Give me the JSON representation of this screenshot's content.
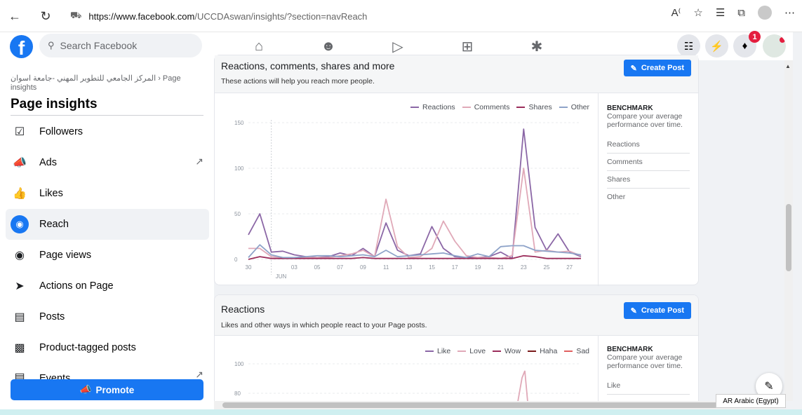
{
  "browser": {
    "url_host": "https://www.facebook.com",
    "url_path": "/UCCDAswan/insights/?section=navReach"
  },
  "fb": {
    "search_placeholder": "Search Facebook",
    "notification_count": "1"
  },
  "sidebar": {
    "breadcrumb": "المركز الجامعي للتطوير المهني -جامعة اسوان › Page insights",
    "title": "Page insights",
    "items": [
      {
        "label": "Followers",
        "icon": "followers-icon"
      },
      {
        "label": "Ads",
        "icon": "megaphone-icon",
        "external": true
      },
      {
        "label": "Likes",
        "icon": "thumbs-up-icon"
      },
      {
        "label": "Reach",
        "icon": "reach-icon",
        "active": true
      },
      {
        "label": "Page views",
        "icon": "eye-icon"
      },
      {
        "label": "Actions on Page",
        "icon": "cursor-icon"
      },
      {
        "label": "Posts",
        "icon": "posts-icon"
      },
      {
        "label": "Product-tagged posts",
        "icon": "tag-icon"
      },
      {
        "label": "Events",
        "icon": "calendar-icon",
        "external": true
      }
    ],
    "promote_label": "Promote"
  },
  "cards": {
    "reach": {
      "title": "Reactions, comments, shares and more",
      "desc": "These actions will help you reach more people.",
      "create_post": "Create Post",
      "benchmark": {
        "title": "BENCHMARK",
        "desc": "Compare your average performance over time.",
        "items": [
          "Reactions",
          "Comments",
          "Shares",
          "Other"
        ]
      }
    },
    "reactions": {
      "title": "Reactions",
      "desc": "Likes and other ways in which people react to your Page posts.",
      "create_post": "Create Post",
      "benchmark": {
        "title": "BENCHMARK",
        "desc": "Compare your average performance over time.",
        "items": [
          "Like"
        ]
      }
    }
  },
  "status": {
    "language": "AR Arabic (Egypt)"
  },
  "chart_data": [
    {
      "type": "line",
      "x": [
        "30",
        "31",
        "01",
        "02",
        "03",
        "04",
        "05",
        "06",
        "07",
        "08",
        "09",
        "10",
        "11",
        "12",
        "13",
        "14",
        "15",
        "16",
        "17",
        "18",
        "19",
        "20",
        "21",
        "22",
        "23",
        "24",
        "25",
        "26",
        "27",
        "28"
      ],
      "tick_labels": [
        "30",
        "03",
        "05",
        "07",
        "09",
        "11",
        "13",
        "15",
        "17",
        "19",
        "21",
        "23",
        "25",
        "27"
      ],
      "month_label": "JUN",
      "ylim": [
        0,
        150
      ],
      "yticks": [
        0,
        50,
        100,
        150
      ],
      "legend_position": "top-right",
      "series": [
        {
          "name": "Reactions",
          "color": "#8b67a6",
          "values": [
            27,
            50,
            8,
            9,
            5,
            3,
            2,
            3,
            7,
            4,
            12,
            3,
            40,
            10,
            4,
            6,
            36,
            12,
            3,
            2,
            2,
            3,
            8,
            1,
            143,
            35,
            10,
            28,
            8,
            3
          ]
        },
        {
          "name": "Comments",
          "color": "#e0a9b8",
          "values": [
            12,
            12,
            3,
            2,
            2,
            2,
            2,
            2,
            4,
            6,
            10,
            3,
            66,
            14,
            2,
            3,
            12,
            42,
            20,
            4,
            2,
            2,
            1,
            4,
            100,
            8,
            10,
            8,
            9,
            4
          ]
        },
        {
          "name": "Shares",
          "color": "#9b2d5b",
          "values": [
            0,
            3,
            1,
            1,
            1,
            1,
            1,
            1,
            1,
            1,
            2,
            1,
            1,
            1,
            1,
            1,
            1,
            1,
            1,
            1,
            1,
            1,
            1,
            1,
            4,
            3,
            1,
            1,
            1,
            1
          ]
        },
        {
          "name": "Other",
          "color": "#8ea3c9",
          "values": [
            2,
            16,
            5,
            2,
            2,
            3,
            4,
            4,
            3,
            4,
            5,
            3,
            10,
            3,
            4,
            5,
            6,
            7,
            4,
            2,
            6,
            3,
            14,
            15,
            15,
            10,
            9,
            8,
            7,
            5
          ]
        }
      ]
    },
    {
      "type": "line",
      "ylim": [
        70,
        100
      ],
      "yticks": [
        80,
        100
      ],
      "legend_position": "top-right",
      "series": [
        {
          "name": "Like",
          "color": "#8b67a6"
        },
        {
          "name": "Love",
          "color": "#e0a9b8"
        },
        {
          "name": "Wow",
          "color": "#9b2d5b"
        },
        {
          "name": "Haha",
          "color": "#7a1a1a"
        },
        {
          "name": "Sad",
          "color": "#e06060"
        }
      ]
    }
  ]
}
